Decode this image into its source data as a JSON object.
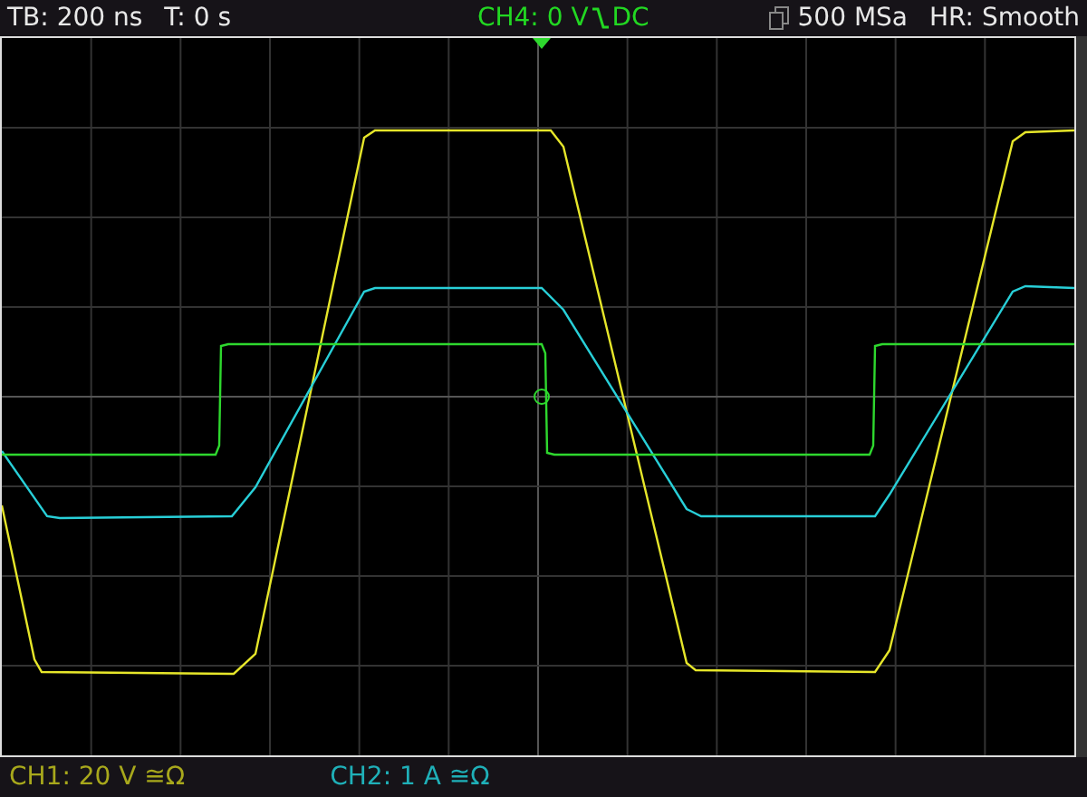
{
  "status_bar": {
    "timebase": "TB: 200 ns",
    "trigger_time": "T: 0 s",
    "trigger_source": "CH4: 0 V",
    "trigger_coupling": "DC",
    "sample_rate": "500 MSa",
    "acquisition": "HR: Smooth"
  },
  "channels": [
    {
      "label": "CH1: 20 V ≅Ω",
      "color": "#a8a81c"
    },
    {
      "label": "CH2: 1 A ≅Ω",
      "color": "#1fb0b8"
    }
  ]
}
